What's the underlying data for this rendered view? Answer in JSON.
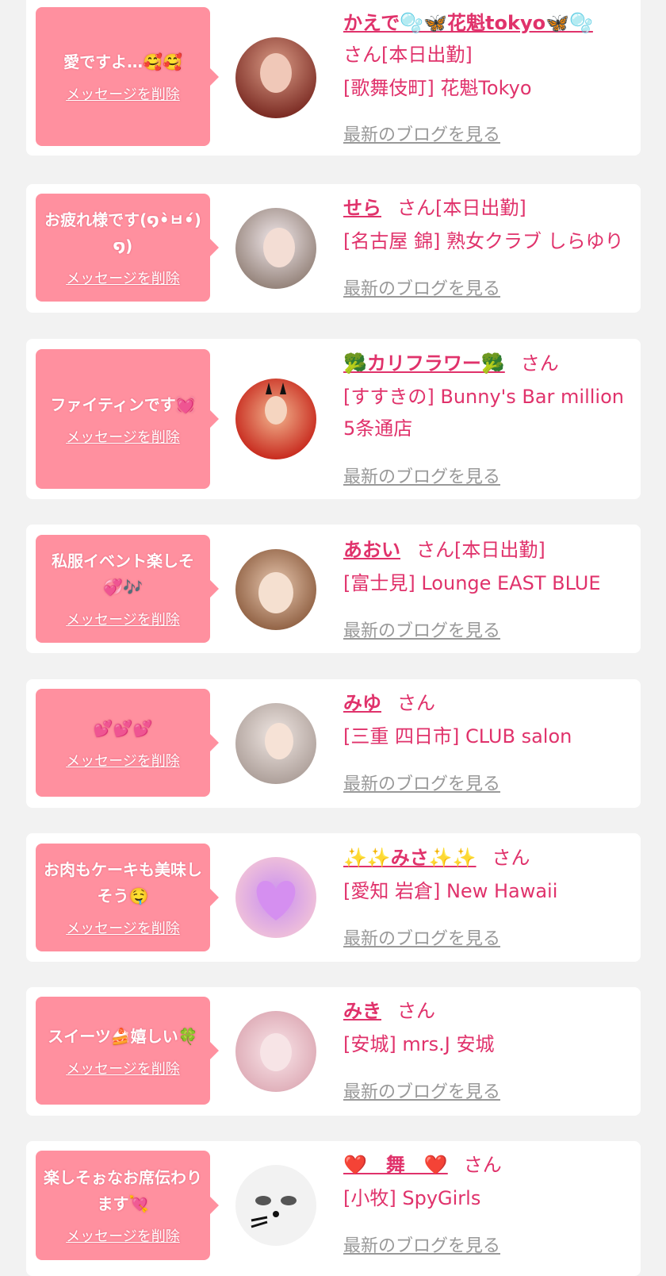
{
  "items": [
    {
      "message": "愛ですよ…🥰🥰",
      "delete_label": "メッセージを削除",
      "name": "かえで🫧🦋花魁tokyo🦋🫧",
      "honorific": "さん",
      "status": "[本日出勤]",
      "shop": "[歌舞伎町] 花魁Tokyo",
      "blog_label": "最新のブログを見る"
    },
    {
      "message": "お疲れ様です(໑•̀ㅂ•́)໑)",
      "delete_label": "メッセージを削除",
      "name": "せら",
      "honorific": "さん",
      "status": "[本日出勤]",
      "shop": "[名古屋 錦] 熟女クラブ しらゆり",
      "blog_label": "最新のブログを見る"
    },
    {
      "message": "ファイティンです💓",
      "delete_label": "メッセージを削除",
      "name": "🥦カリフラワー🥦",
      "honorific": "さん",
      "status": "",
      "shop": "[すすきの] Bunny's Bar million 5条通店",
      "blog_label": "最新のブログを見る"
    },
    {
      "message": "私服イベント楽しそ💞🎶",
      "delete_label": "メッセージを削除",
      "name": "あおい",
      "honorific": "さん",
      "status": "[本日出勤]",
      "shop": "[富士見] Lounge EAST BLUE",
      "blog_label": "最新のブログを見る"
    },
    {
      "message": "💕💕💕",
      "delete_label": "メッセージを削除",
      "name": "みゆ",
      "honorific": "さん",
      "status": "",
      "shop": "[三重 四日市] CLUB salon",
      "blog_label": "最新のブログを見る"
    },
    {
      "message": "お肉もケーキも美味しそう🤤",
      "delete_label": "メッセージを削除",
      "name": "✨✨みさ✨✨",
      "honorific": "さん",
      "status": "",
      "shop": "[愛知 岩倉] New Hawaii",
      "blog_label": "最新のブログを見る"
    },
    {
      "message": "スイーツ🍰嬉しい🍀",
      "delete_label": "メッセージを削除",
      "name": "みき",
      "honorific": "さん",
      "status": "",
      "shop": "[安城] mrs.J 安城",
      "blog_label": "最新のブログを見る"
    },
    {
      "message": "楽しそぉなお席伝わります💘",
      "delete_label": "メッセージを削除",
      "name": "❤️　舞　❤️",
      "honorific": "さん",
      "status": "",
      "shop": "[小牧] SpyGirls",
      "blog_label": "最新のブログを見る"
    }
  ],
  "avatar_colors": [
    [
      "#7a2a22",
      "#d99b86"
    ],
    [
      "#d9cfd2",
      "#f1e8eb"
    ],
    [
      "#c41e14",
      "#f2b48e"
    ],
    [
      "#8a5a3c",
      "#e8c8b0"
    ],
    [
      "#a89a94",
      "#efe6e2"
    ],
    [
      "#f5c8d6",
      "#c88ef0"
    ],
    [
      "#f0c0c8",
      "#fae6ea"
    ],
    [
      "#e8e8e8",
      "#ffffff"
    ]
  ]
}
